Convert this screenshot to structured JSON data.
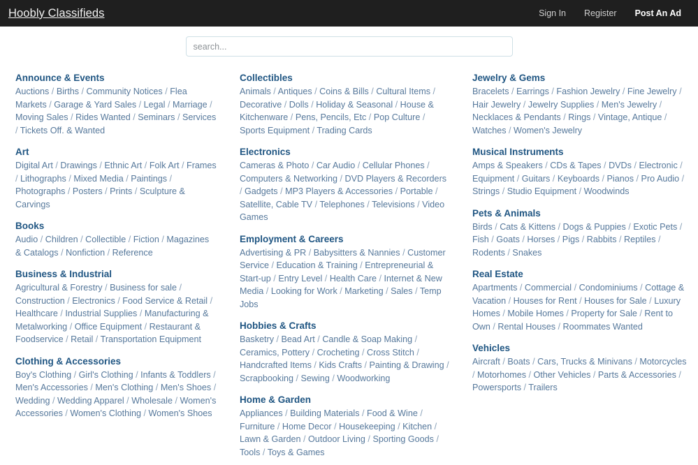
{
  "header": {
    "brand": "Hoobly Classifieds",
    "nav": [
      {
        "label": "Sign In",
        "name": "sign-in-link",
        "strong": false
      },
      {
        "label": "Register",
        "name": "register-link",
        "strong": false
      },
      {
        "label": "Post An Ad",
        "name": "post-an-ad-link",
        "strong": true
      }
    ]
  },
  "search": {
    "placeholder": "search...",
    "value": ""
  },
  "colors": {
    "topbar_background": "#1f1f1f",
    "heading": "#1f5582",
    "link": "#56789b",
    "search_border": "#cfe0e6",
    "page_background": "#ffffff"
  },
  "columns": [
    {
      "name": "column-1",
      "categories": [
        {
          "title": "Announce & Events",
          "items": [
            "Auctions",
            "Births",
            "Community Notices",
            "Flea Markets",
            "Garage & Yard Sales",
            "Legal",
            "Marriage",
            "Moving Sales",
            "Rides Wanted",
            "Seminars",
            "Services",
            "Tickets Off. & Wanted"
          ]
        },
        {
          "title": "Art",
          "items": [
            "Digital Art",
            "Drawings",
            "Ethnic Art",
            "Folk Art",
            "Frames",
            "Lithographs",
            "Mixed Media",
            "Paintings",
            "Photographs",
            "Posters",
            "Prints",
            "Sculpture & Carvings"
          ]
        },
        {
          "title": "Books",
          "items": [
            "Audio",
            "Children",
            "Collectible",
            "Fiction",
            "Magazines & Catalogs",
            "Nonfiction",
            "Reference"
          ]
        },
        {
          "title": "Business & Industrial",
          "items": [
            "Agricultural & Forestry",
            "Business for sale",
            "Construction",
            "Electronics",
            "Food Service & Retail",
            "Healthcare",
            "Industrial Supplies",
            "Manufacturing & Metalworking",
            "Office Equipment",
            "Restaurant & Foodservice",
            "Retail",
            "Transportation Equipment"
          ]
        },
        {
          "title": "Clothing & Accessories",
          "items": [
            "Boy's Clothing",
            "Girl's Clothing",
            "Infants & Toddlers",
            "Men's Accessories",
            "Men's Clothing",
            "Men's Shoes",
            "Wedding",
            "Wedding Apparel",
            "Wholesale",
            "Women's Accessories",
            "Women's Clothing",
            "Women's Shoes"
          ]
        }
      ]
    },
    {
      "name": "column-2",
      "categories": [
        {
          "title": "Collectibles",
          "items": [
            "Animals",
            "Antiques",
            "Coins & Bills",
            "Cultural Items",
            "Decorative",
            "Dolls",
            "Holiday & Seasonal",
            "House & Kitchenware",
            "Pens, Pencils, Etc",
            "Pop Culture",
            "Sports Equipment",
            "Trading Cards"
          ]
        },
        {
          "title": "Electronics",
          "items": [
            "Cameras & Photo",
            "Car Audio",
            "Cellular Phones",
            "Computers & Networking",
            "DVD Players & Recorders",
            "Gadgets",
            "MP3 Players & Accessories",
            "Portable",
            "Satellite, Cable TV",
            "Telephones",
            "Televisions",
            "Video Games"
          ]
        },
        {
          "title": "Employment & Careers",
          "items": [
            "Advertising & PR",
            "Babysitters & Nannies",
            "Customer Service",
            "Education & Training",
            "Entrepreneurial & Start-up",
            "Entry Level",
            "Health Care",
            "Internet & New Media",
            "Looking for Work",
            "Marketing",
            "Sales",
            "Temp Jobs"
          ]
        },
        {
          "title": "Hobbies & Crafts",
          "items": [
            "Basketry",
            "Bead Art",
            "Candle & Soap Making",
            "Ceramics, Pottery",
            "Crocheting",
            "Cross Stitch",
            "Handcrafted Items",
            "Kids Crafts",
            "Painting & Drawing",
            "Scrapbooking",
            "Sewing",
            "Woodworking"
          ]
        },
        {
          "title": "Home & Garden",
          "items": [
            "Appliances",
            "Building Materials",
            "Food & Wine",
            "Furniture",
            "Home Decor",
            "Housekeeping",
            "Kitchen",
            "Lawn & Garden",
            "Outdoor Living",
            "Sporting Goods",
            "Tools",
            "Toys & Games"
          ]
        }
      ]
    },
    {
      "name": "column-3",
      "categories": [
        {
          "title": "Jewelry & Gems",
          "items": [
            "Bracelets",
            "Earrings",
            "Fashion Jewelry",
            "Fine Jewelry",
            "Hair Jewelry",
            "Jewelry Supplies",
            "Men's Jewelry",
            "Necklaces & Pendants",
            "Rings",
            "Vintage, Antique",
            "Watches",
            "Women's Jewelry"
          ]
        },
        {
          "title": "Musical Instruments",
          "items": [
            "Amps & Speakers",
            "CDs & Tapes",
            "DVDs",
            "Electronic",
            "Equipment",
            "Guitars",
            "Keyboards",
            "Pianos",
            "Pro Audio",
            "Strings",
            "Studio Equipment",
            "Woodwinds"
          ]
        },
        {
          "title": "Pets & Animals",
          "items": [
            "Birds",
            "Cats & Kittens",
            "Dogs & Puppies",
            "Exotic Pets",
            "Fish",
            "Goats",
            "Horses",
            "Pigs",
            "Rabbits",
            "Reptiles",
            "Rodents",
            "Snakes"
          ]
        },
        {
          "title": "Real Estate",
          "items": [
            "Apartments",
            "Commercial",
            "Condominiums",
            "Cottage & Vacation",
            "Houses for Rent",
            "Houses for Sale",
            "Luxury Homes",
            "Mobile Homes",
            "Property for Sale",
            "Rent to Own",
            "Rental Houses",
            "Roommates Wanted"
          ]
        },
        {
          "title": "Vehicles",
          "items": [
            "Aircraft",
            "Boats",
            "Cars, Trucks & Minivans",
            "Motorcycles",
            "Motorhomes",
            "Other Vehicles",
            "Parts & Accessories",
            "Powersports",
            "Trailers"
          ]
        }
      ]
    }
  ]
}
